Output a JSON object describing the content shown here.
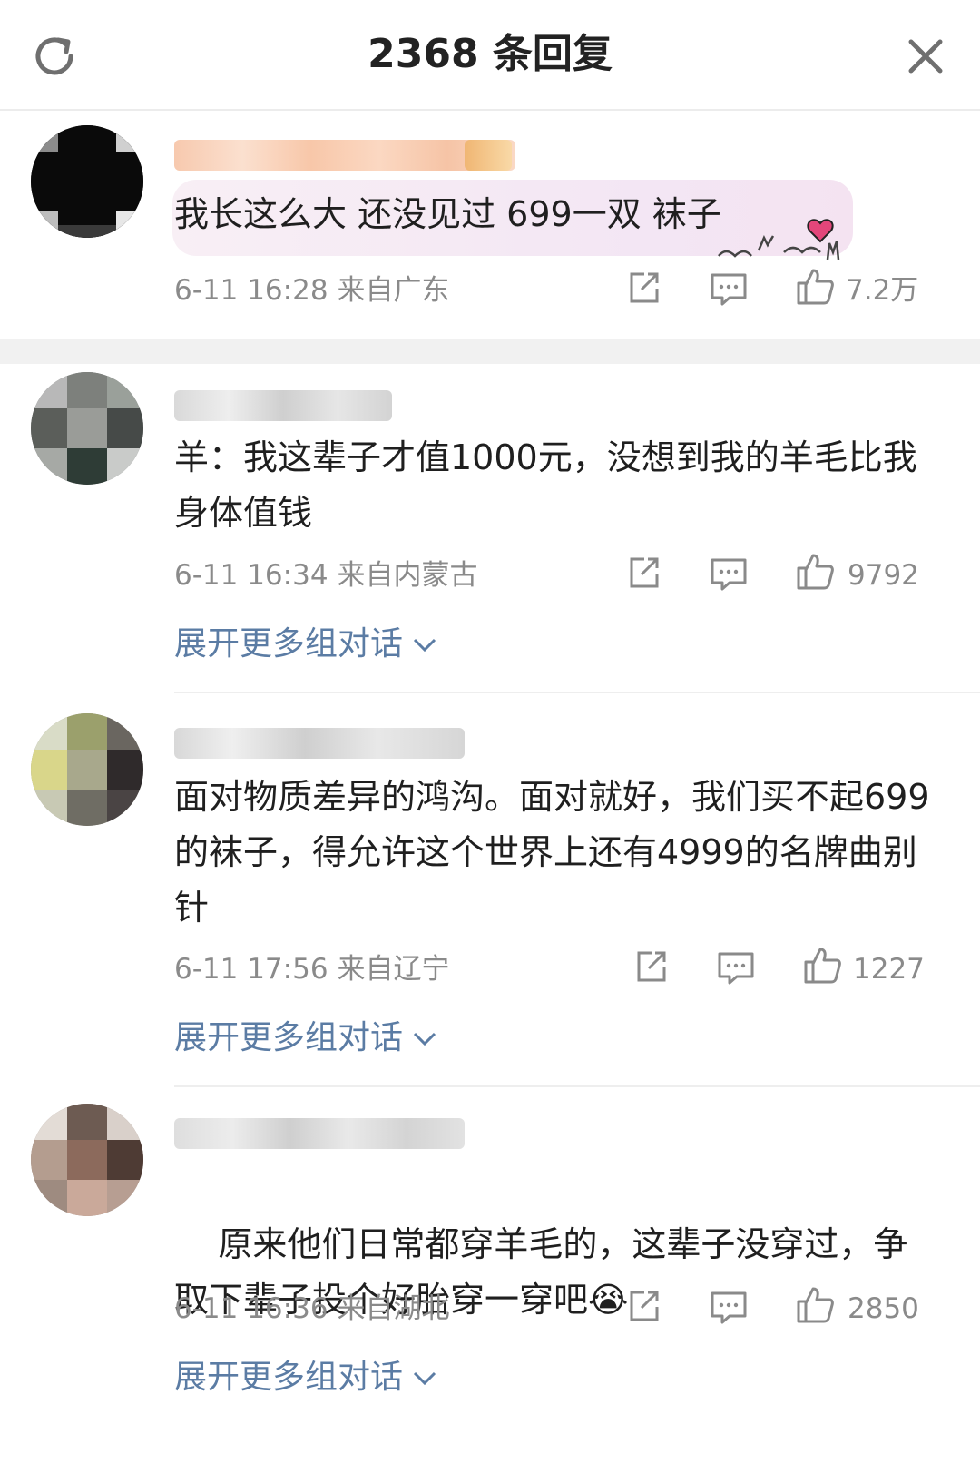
{
  "header": {
    "title": "2368 条回复",
    "refresh_icon": "refresh-icon",
    "close_icon": "close-icon"
  },
  "top_comment": {
    "text": "我长这么大 还没见过 699一双 袜子",
    "time": "6-11 16:28",
    "location": "来自广东",
    "likes": "7.2万"
  },
  "replies": [
    {
      "text": "羊：我这辈子才值1000元，没想到我的羊毛比我身体值钱",
      "time": "6-11 16:34",
      "location": "来自内蒙古",
      "likes": "9792",
      "expand": "展开更多组对话"
    },
    {
      "text": "面对物质差异的鸿沟。面对就好，我们买不起699的袜子，得允许这个世界上还有4999的名牌曲别针",
      "time": "6-11 17:56",
      "location": "来自辽宁",
      "likes": "1227",
      "expand": "展开更多组对话"
    },
    {
      "text": "原来他们日常都穿羊毛的，这辈子没穿过，争取下辈子投个好胎穿一穿吧",
      "time": "6-11 16:36",
      "location": "来自湖北",
      "likes": "2850",
      "expand": "展开更多组对话",
      "emoji": "😭"
    }
  ],
  "colors": {
    "link": "#5b7ca4",
    "meta": "#8a8a8a"
  }
}
